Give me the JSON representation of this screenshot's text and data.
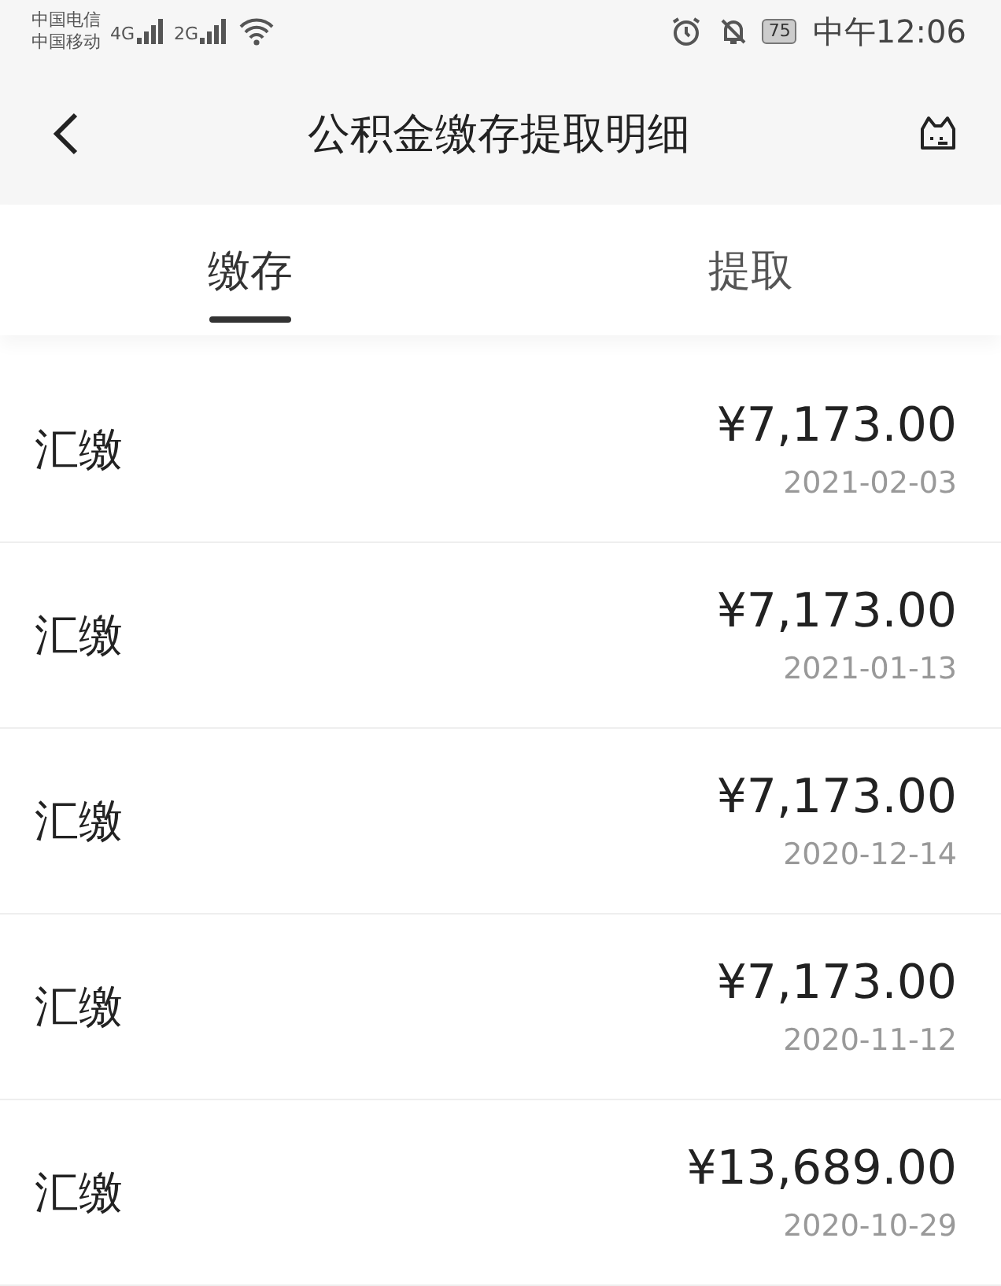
{
  "status_bar": {
    "carriers": [
      "中国电信",
      "中国移动"
    ],
    "networks": [
      "4G",
      "2G"
    ],
    "battery": "75",
    "time": "中午12:06"
  },
  "header": {
    "title": "公积金缴存提取明细"
  },
  "tabs": [
    {
      "label": "缴存",
      "selected": true
    },
    {
      "label": "提取",
      "selected": false
    }
  ],
  "records": [
    {
      "type": "汇缴",
      "amount": "¥7,173.00",
      "date": "2021-02-03"
    },
    {
      "type": "汇缴",
      "amount": "¥7,173.00",
      "date": "2021-01-13"
    },
    {
      "type": "汇缴",
      "amount": "¥7,173.00",
      "date": "2020-12-14"
    },
    {
      "type": "汇缴",
      "amount": "¥7,173.00",
      "date": "2020-11-12"
    },
    {
      "type": "汇缴",
      "amount": "¥13,689.00",
      "date": "2020-10-29"
    }
  ]
}
